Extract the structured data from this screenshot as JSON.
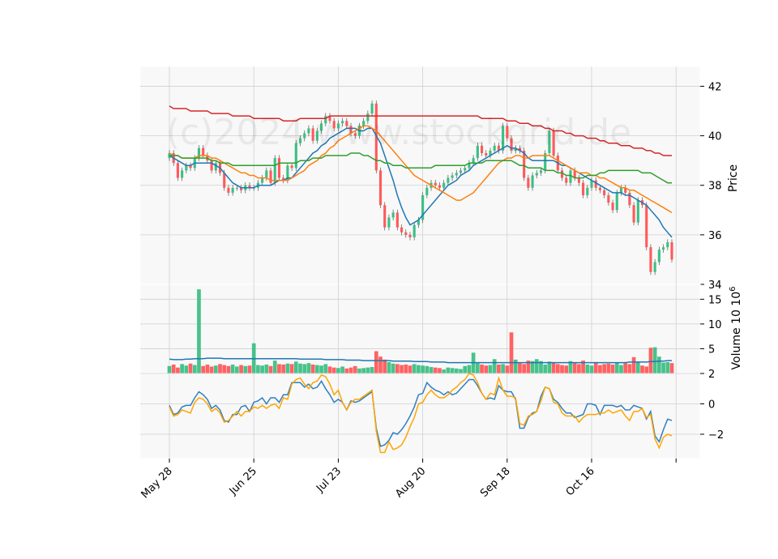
{
  "watermark": "(c)2024 www.stockgrid.de",
  "colors": {
    "up": "#3dbf85",
    "down": "#ff5a5a",
    "ma_fast": "#1f77b4",
    "ma_mid": "#ff7f0e",
    "ma_slow": "#2ca02c",
    "ma_long": "#d62728",
    "macd": "#2f7fc0",
    "signal": "#ffa500",
    "volume_avg": "#1f77b4",
    "panel_bg": "#f8f8f8",
    "grid": "#d0d0d0"
  },
  "chart_data": [
    {
      "type": "candlestick",
      "panel": "price",
      "ylabel": "Price",
      "ylim": [
        34,
        42.8
      ],
      "yticks": [
        34,
        36,
        38,
        40,
        42
      ],
      "xtick_labels": [
        "May 28",
        "Jun 25",
        "Jul 23",
        "Aug 20",
        "Sep 18",
        "Oct 16"
      ],
      "xtick_index": [
        0,
        20,
        40,
        60,
        80,
        100
      ],
      "grid": true,
      "close": [
        39.3,
        38.9,
        38.3,
        38.6,
        38.8,
        38.7,
        39.1,
        39.5,
        39.2,
        39.0,
        38.6,
        38.9,
        38.5,
        37.9,
        37.7,
        37.9,
        37.9,
        37.8,
        38.0,
        37.9,
        37.9,
        38.1,
        38.3,
        38.6,
        38.1,
        39.1,
        38.3,
        38.2,
        38.8,
        38.7,
        39.7,
        39.9,
        40.1,
        40.3,
        39.8,
        40.2,
        40.5,
        40.8,
        40.6,
        40.3,
        40.5,
        40.6,
        40.4,
        40.1,
        40.0,
        40.4,
        40.6,
        40.9,
        41.3,
        38.6,
        37.2,
        36.3,
        36.7,
        36.9,
        36.3,
        36.1,
        36.0,
        35.9,
        36.4,
        36.6,
        37.6,
        37.9,
        38.1,
        38.0,
        37.9,
        38.1,
        38.3,
        38.4,
        38.5,
        38.6,
        38.7,
        38.9,
        39.1,
        39.6,
        39.3,
        39.2,
        39.4,
        39.6,
        39.4,
        40.4,
        39.9,
        39.4,
        39.5,
        39.4,
        38.3,
        37.9,
        38.4,
        38.5,
        38.6,
        39.3,
        40.2,
        39.2,
        38.6,
        38.3,
        38.1,
        38.6,
        38.3,
        38.1,
        37.6,
        37.9,
        38.2,
        37.9,
        37.8,
        37.6,
        37.3,
        37.0,
        37.7,
        37.9,
        37.7,
        37.2,
        36.5,
        37.4,
        37.2,
        35.5,
        34.5,
        34.9,
        35.4,
        35.5,
        35.7,
        35.0
      ],
      "series": [
        {
          "name": "",
          "key": "ma_fast",
          "values": [
            39.2,
            39.1,
            39.0,
            38.9,
            38.8,
            38.8,
            38.9,
            38.9,
            38.9,
            38.9,
            38.9,
            38.8,
            38.7,
            38.5,
            38.3,
            38.1,
            38.0,
            37.9,
            37.9,
            37.9,
            37.9,
            38.0,
            38.0,
            38.0,
            38.0,
            38.1,
            38.2,
            38.2,
            38.3,
            38.3,
            38.5,
            38.7,
            38.9,
            39.1,
            39.3,
            39.4,
            39.6,
            39.7,
            39.9,
            40.0,
            40.1,
            40.2,
            40.3,
            40.3,
            40.3,
            40.2,
            40.2,
            40.3,
            40.3,
            40.0,
            39.7,
            39.2,
            38.7,
            38.2,
            37.6,
            37.1,
            36.7,
            36.4,
            36.5,
            36.6,
            36.8,
            37.0,
            37.2,
            37.4,
            37.6,
            37.8,
            38.0,
            38.1,
            38.2,
            38.4,
            38.5,
            38.6,
            38.8,
            38.9,
            39.0,
            39.1,
            39.2,
            39.3,
            39.4,
            39.5,
            39.6,
            39.5,
            39.5,
            39.4,
            39.3,
            39.1,
            39.0,
            39.0,
            39.0,
            39.0,
            39.0,
            39.0,
            38.9,
            38.8,
            38.8,
            38.7,
            38.6,
            38.5,
            38.4,
            38.3,
            38.2,
            38.1,
            38.0,
            37.9,
            37.8,
            37.7,
            37.7,
            37.7,
            37.6,
            37.6,
            37.5,
            37.4,
            37.3,
            37.2,
            37.0,
            36.8,
            36.6,
            36.3,
            36.1,
            35.9
          ]
        },
        {
          "name": "",
          "key": "ma_mid",
          "values": [
            39.3,
            39.2,
            39.2,
            39.1,
            39.1,
            39.1,
            39.1,
            39.2,
            39.2,
            39.2,
            39.1,
            39.1,
            39.0,
            38.9,
            38.8,
            38.7,
            38.6,
            38.5,
            38.5,
            38.4,
            38.4,
            38.3,
            38.3,
            38.3,
            38.2,
            38.2,
            38.2,
            38.2,
            38.2,
            38.3,
            38.4,
            38.5,
            38.6,
            38.8,
            38.9,
            39.0,
            39.2,
            39.3,
            39.5,
            39.6,
            39.8,
            39.9,
            40.0,
            40.1,
            40.2,
            40.3,
            40.4,
            40.4,
            40.3,
            40.2,
            40.0,
            39.8,
            39.6,
            39.4,
            39.2,
            39.0,
            38.8,
            38.6,
            38.4,
            38.3,
            38.2,
            38.1,
            38.0,
            37.9,
            37.8,
            37.7,
            37.6,
            37.5,
            37.4,
            37.4,
            37.5,
            37.6,
            37.7,
            37.9,
            38.1,
            38.3,
            38.5,
            38.7,
            38.9,
            39.0,
            39.1,
            39.1,
            39.2,
            39.2,
            39.1,
            39.1,
            39.2,
            39.2,
            39.2,
            39.2,
            39.2,
            39.1,
            39.0,
            38.9,
            38.8,
            38.7,
            38.6,
            38.5,
            38.5,
            38.5,
            38.4,
            38.4,
            38.3,
            38.3,
            38.2,
            38.1,
            38.0,
            37.9,
            37.9,
            37.8,
            37.8,
            37.7,
            37.6,
            37.5,
            37.4,
            37.3,
            37.2,
            37.1,
            37.0,
            36.9
          ]
        },
        {
          "name": "",
          "key": "ma_slow",
          "values": [
            39.2,
            39.2,
            39.2,
            39.1,
            39.1,
            39.1,
            39.1,
            39.1,
            39.1,
            39.1,
            39.0,
            39.0,
            38.9,
            38.9,
            38.9,
            38.8,
            38.8,
            38.8,
            38.8,
            38.8,
            38.8,
            38.8,
            38.8,
            38.8,
            38.8,
            38.8,
            38.9,
            38.9,
            38.9,
            38.9,
            38.9,
            39.0,
            39.0,
            39.0,
            39.1,
            39.1,
            39.1,
            39.2,
            39.2,
            39.2,
            39.2,
            39.2,
            39.2,
            39.3,
            39.3,
            39.3,
            39.2,
            39.2,
            39.1,
            39.0,
            39.0,
            38.9,
            38.9,
            38.8,
            38.8,
            38.8,
            38.7,
            38.7,
            38.7,
            38.7,
            38.7,
            38.7,
            38.7,
            38.8,
            38.8,
            38.8,
            38.8,
            38.8,
            38.8,
            38.8,
            38.8,
            38.9,
            38.9,
            38.9,
            38.9,
            39.0,
            39.0,
            39.0,
            39.0,
            39.0,
            39.0,
            39.0,
            38.9,
            38.8,
            38.8,
            38.7,
            38.7,
            38.7,
            38.7,
            38.6,
            38.6,
            38.6,
            38.5,
            38.5,
            38.4,
            38.4,
            38.3,
            38.3,
            38.3,
            38.4,
            38.4,
            38.4,
            38.5,
            38.5,
            38.6,
            38.6,
            38.6,
            38.6,
            38.6,
            38.6,
            38.6,
            38.6,
            38.5,
            38.5,
            38.5,
            38.4,
            38.3,
            38.2,
            38.1,
            38.1
          ]
        },
        {
          "name": "",
          "key": "ma_long",
          "values": [
            41.2,
            41.1,
            41.1,
            41.1,
            41.1,
            41.0,
            41.0,
            41.0,
            41.0,
            41.0,
            40.9,
            40.9,
            40.9,
            40.9,
            40.9,
            40.8,
            40.8,
            40.8,
            40.8,
            40.8,
            40.7,
            40.7,
            40.7,
            40.7,
            40.7,
            40.7,
            40.7,
            40.6,
            40.6,
            40.6,
            40.6,
            40.7,
            40.7,
            40.7,
            40.7,
            40.7,
            40.7,
            40.7,
            40.8,
            40.8,
            40.8,
            40.8,
            40.8,
            40.8,
            40.8,
            40.8,
            40.8,
            40.8,
            40.8,
            40.8,
            40.8,
            40.8,
            40.8,
            40.8,
            40.8,
            40.8,
            40.8,
            40.8,
            40.8,
            40.8,
            40.8,
            40.8,
            40.8,
            40.8,
            40.8,
            40.8,
            40.8,
            40.8,
            40.8,
            40.8,
            40.8,
            40.8,
            40.8,
            40.8,
            40.7,
            40.7,
            40.7,
            40.7,
            40.7,
            40.7,
            40.6,
            40.6,
            40.6,
            40.5,
            40.5,
            40.5,
            40.4,
            40.4,
            40.4,
            40.3,
            40.3,
            40.2,
            40.2,
            40.2,
            40.1,
            40.1,
            40.0,
            40.0,
            40.0,
            39.9,
            39.9,
            39.9,
            39.8,
            39.8,
            39.7,
            39.7,
            39.7,
            39.6,
            39.6,
            39.6,
            39.5,
            39.5,
            39.5,
            39.4,
            39.4,
            39.3,
            39.3,
            39.2,
            39.2,
            39.2
          ]
        }
      ]
    },
    {
      "type": "bar",
      "panel": "volume",
      "ylabel": "Volume  10⁶",
      "ylabel_exponent": "6",
      "ylim": [
        0,
        18
      ],
      "yticks": [
        5,
        10,
        15
      ],
      "grid": true,
      "values": [
        1.5,
        1.8,
        1.2,
        1.9,
        1.6,
        2.0,
        1.7,
        17.0,
        1.5,
        1.8,
        1.4,
        1.6,
        1.9,
        1.7,
        1.5,
        1.8,
        1.4,
        1.7,
        1.5,
        1.6,
        6.1,
        1.7,
        1.6,
        1.8,
        1.5,
        2.6,
        1.9,
        1.8,
        2.0,
        1.9,
        2.4,
        2.0,
        1.9,
        2.1,
        1.8,
        1.7,
        1.6,
        1.9,
        1.4,
        1.2,
        1.1,
        1.4,
        1.0,
        1.2,
        1.5,
        1.0,
        1.1,
        1.2,
        1.3,
        4.5,
        3.4,
        2.8,
        2.3,
        2.0,
        1.9,
        1.7,
        1.8,
        1.6,
        1.9,
        1.7,
        1.6,
        1.5,
        1.3,
        1.2,
        1.1,
        0.8,
        1.2,
        1.1,
        1.0,
        0.9,
        1.5,
        1.7,
        4.2,
        2.1,
        1.8,
        1.6,
        1.7,
        2.9,
        1.8,
        1.9,
        1.6,
        8.3,
        2.8,
        2.1,
        1.9,
        2.6,
        2.5,
        2.9,
        2.5,
        1.8,
        2.4,
        2.2,
        1.9,
        1.7,
        1.6,
        2.5,
        2.1,
        1.9,
        2.6,
        1.8,
        1.6,
        2.3,
        1.7,
        1.9,
        2.0,
        1.8,
        2.2,
        1.7,
        2.1,
        1.9,
        3.3,
        2.4,
        1.6,
        1.4,
        5.2,
        5.3,
        3.4,
        2.2,
        2.3,
        2.1
      ],
      "avg": [
        2.9,
        2.8,
        2.8,
        2.8,
        2.9,
        2.9,
        3.0,
        3.0,
        3.0,
        3.1,
        3.1,
        3.1,
        3.1,
        3.0,
        3.0,
        3.0,
        3.0,
        3.0,
        3.0,
        3.0,
        3.0,
        3.0,
        3.0,
        3.0,
        3.0,
        3.0,
        3.0,
        3.0,
        3.0,
        3.0,
        3.0,
        2.9,
        2.9,
        2.9,
        2.9,
        2.9,
        2.9,
        2.8,
        2.8,
        2.8,
        2.8,
        2.8,
        2.7,
        2.7,
        2.7,
        2.7,
        2.6,
        2.6,
        2.6,
        2.6,
        2.6,
        2.6,
        2.6,
        2.5,
        2.5,
        2.5,
        2.5,
        2.5,
        2.4,
        2.4,
        2.4,
        2.4,
        2.3,
        2.3,
        2.3,
        2.3,
        2.2,
        2.2,
        2.2,
        2.2,
        2.2,
        2.2,
        2.2,
        2.2,
        2.2,
        2.2,
        2.2,
        2.2,
        2.2,
        2.2,
        2.2,
        2.2,
        2.2,
        2.2,
        2.2,
        2.2,
        2.2,
        2.2,
        2.2,
        2.2,
        2.2,
        2.2,
        2.2,
        2.2,
        2.2,
        2.2,
        2.2,
        2.2,
        2.2,
        2.2,
        2.2,
        2.2,
        2.2,
        2.2,
        2.2,
        2.2,
        2.2,
        2.2,
        2.2,
        2.3,
        2.3,
        2.3,
        2.3,
        2.3,
        2.4,
        2.4,
        2.5,
        2.5,
        2.6,
        2.6
      ]
    },
    {
      "type": "line",
      "panel": "oscillator",
      "ylim": [
        -3.6,
        2.0
      ],
      "yticks": [
        -2,
        0,
        2
      ],
      "grid": true,
      "series": [
        {
          "name": "",
          "key": "macd",
          "values": [
            -0.1,
            -0.7,
            -0.6,
            -0.2,
            -0.1,
            -0.1,
            0.4,
            0.8,
            0.6,
            0.3,
            -0.3,
            -0.1,
            -0.4,
            -1.1,
            -1.2,
            -0.7,
            -0.7,
            -0.2,
            -0.1,
            -0.5,
            0.1,
            0.2,
            0.4,
            0.0,
            0.4,
            0.4,
            0.1,
            0.6,
            0.6,
            1.4,
            1.4,
            1.4,
            1.1,
            1.3,
            1.0,
            1.1,
            1.5,
            1.0,
            0.6,
            0.1,
            0.3,
            0.1,
            -0.4,
            0.2,
            0.1,
            0.2,
            0.4,
            0.6,
            0.8,
            -1.6,
            -2.8,
            -2.7,
            -2.4,
            -1.9,
            -2.0,
            -1.7,
            -1.3,
            -0.8,
            -0.2,
            0.6,
            0.7,
            1.4,
            1.1,
            0.9,
            0.8,
            0.6,
            0.8,
            0.6,
            0.7,
            1.0,
            1.3,
            1.6,
            1.6,
            1.2,
            0.7,
            0.3,
            0.4,
            0.3,
            1.2,
            0.9,
            0.8,
            0.8,
            0.3,
            -1.6,
            -1.6,
            -0.9,
            -0.6,
            -0.5,
            0.5,
            1.1,
            1.0,
            0.3,
            0.1,
            -0.3,
            -0.6,
            -0.6,
            -0.9,
            -0.8,
            -0.7,
            0.0,
            0.0,
            -0.1,
            -0.7,
            -0.1,
            -0.1,
            -0.1,
            -0.2,
            -0.1,
            -0.4,
            -0.4,
            -0.1,
            -0.2,
            -0.3,
            -1.0,
            -0.5,
            -2.1,
            -2.5,
            -1.7,
            -1.0,
            -1.1
          ]
        },
        {
          "name": "",
          "key": "signal",
          "values": [
            -0.2,
            -0.8,
            -0.7,
            -0.4,
            -0.5,
            -0.6,
            0.1,
            0.4,
            0.3,
            0.0,
            -0.5,
            -0.3,
            -0.6,
            -1.2,
            -1.1,
            -0.8,
            -0.5,
            -0.8,
            -0.5,
            -0.5,
            -0.2,
            -0.3,
            -0.1,
            -0.3,
            -0.1,
            0.0,
            -0.3,
            0.4,
            0.3,
            1.3,
            1.6,
            1.7,
            1.3,
            1.0,
            1.4,
            1.5,
            1.9,
            1.8,
            1.3,
            0.6,
            0.9,
            0.1,
            -0.4,
            0.1,
            0.3,
            0.3,
            0.5,
            0.7,
            0.9,
            -1.8,
            -3.2,
            -3.2,
            -2.5,
            -3.0,
            -2.9,
            -2.7,
            -2.2,
            -1.5,
            -0.9,
            0.0,
            0.1,
            0.6,
            0.9,
            0.6,
            0.4,
            0.4,
            0.6,
            0.9,
            1.1,
            1.4,
            1.6,
            2.0,
            1.9,
            1.4,
            0.7,
            0.3,
            0.7,
            0.6,
            1.7,
            0.9,
            0.5,
            0.5,
            0.4,
            -1.3,
            -1.4,
            -0.8,
            -0.7,
            -0.5,
            0.2,
            1.1,
            1.0,
            0.1,
            0.0,
            -0.6,
            -0.8,
            -0.8,
            -0.8,
            -1.2,
            -0.9,
            -0.7,
            -0.7,
            -0.7,
            -0.6,
            -0.6,
            -0.4,
            -0.6,
            -0.5,
            -0.4,
            -0.8,
            -1.1,
            -0.5,
            -0.5,
            -0.3,
            -0.9,
            -0.7,
            -2.3,
            -2.9,
            -2.2,
            -2.0,
            -2.1
          ]
        }
      ]
    }
  ]
}
